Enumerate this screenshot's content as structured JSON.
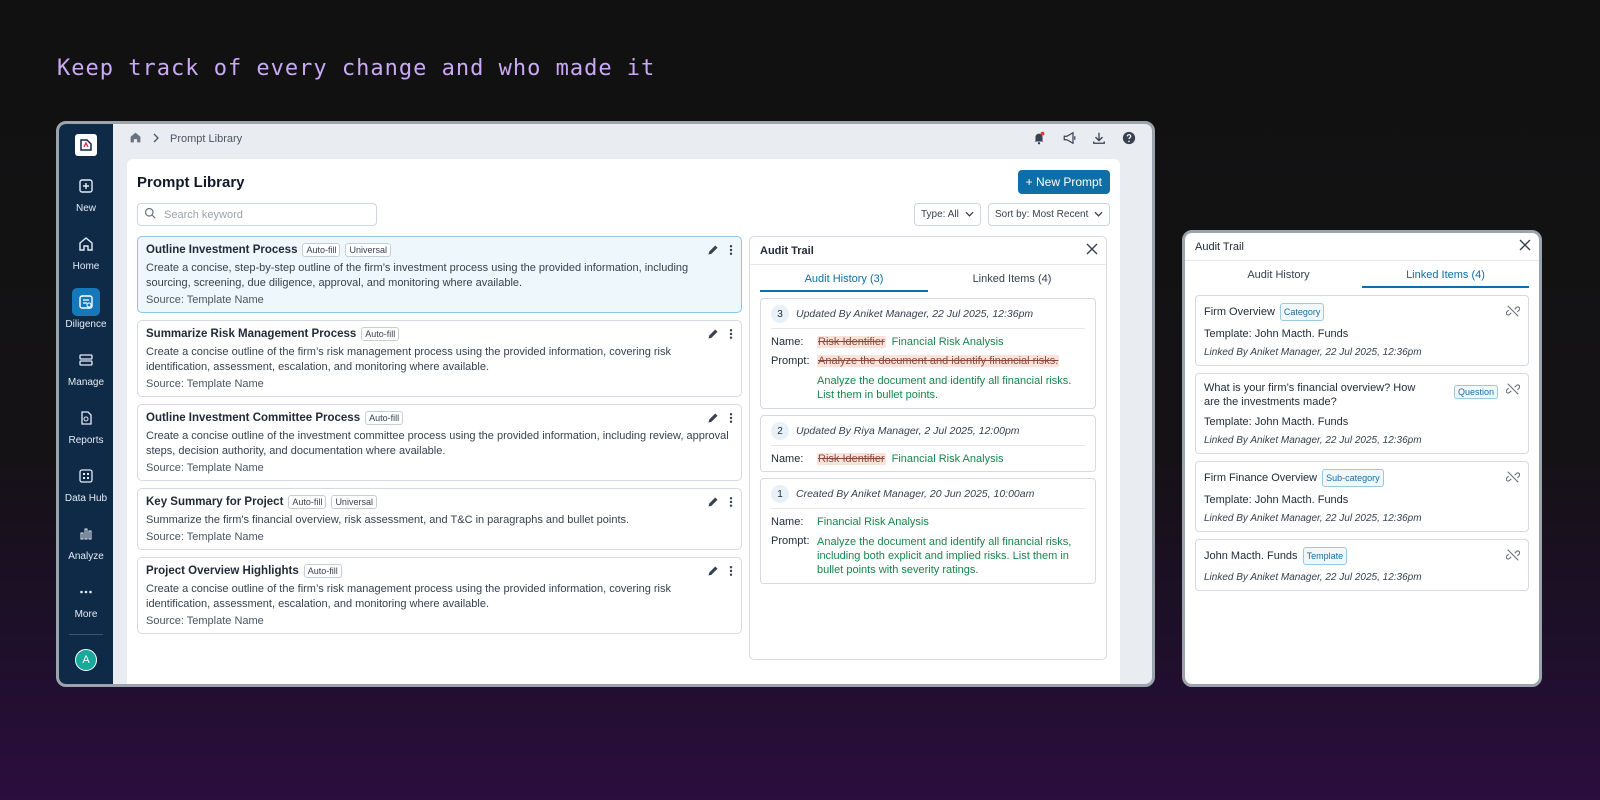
{
  "headline": "Keep track of every change and who made it",
  "rail": {
    "items": [
      {
        "label": "New",
        "icon": "plus-square-icon"
      },
      {
        "label": "Home",
        "icon": "home-icon"
      },
      {
        "label": "Diligence",
        "icon": "diligence-icon",
        "active": true
      },
      {
        "label": "Manage",
        "icon": "manage-icon"
      },
      {
        "label": "Reports",
        "icon": "reports-icon"
      },
      {
        "label": "Data Hub",
        "icon": "data-hub-icon"
      },
      {
        "label": "Analyze",
        "icon": "chart-icon"
      },
      {
        "label": "More",
        "icon": "more-icon"
      }
    ],
    "avatar": "A"
  },
  "breadcrumb": {
    "current": "Prompt Library"
  },
  "page": {
    "title": "Prompt Library",
    "new_button": "+ New Prompt",
    "search_placeholder": "Search keyword",
    "type_filter": "Type: All",
    "sort_filter": "Sort by: Most Recent"
  },
  "prompts": [
    {
      "title": "Outline Investment Process",
      "tags": [
        "Auto-fill",
        "Universal"
      ],
      "desc": "Create a concise, step-by-step outline of the firm’s investment process using the provided information, including sourcing, screening, due diligence, approval, and monitoring where available.",
      "source": "Source: Template Name"
    },
    {
      "title": "Summarize Risk Management Process",
      "tags": [
        "Auto-fill"
      ],
      "desc": "Create a concise outline of the firm’s risk management process using the provided information, covering risk identification, assessment, escalation, and monitoring where available.",
      "source": "Source: Template Name"
    },
    {
      "title": "Outline Investment Committee Process",
      "tags": [
        "Auto-fill"
      ],
      "desc": "Create a concise outline of the investment committee process using the provided information, including review, approval steps, decision authority, and documentation where available.",
      "source": "Source: Template Name"
    },
    {
      "title": "Key Summary for Project",
      "tags": [
        "Auto-fill",
        "Universal"
      ],
      "desc": "Summarize the firm's financial overview, risk assessment, and T&C in paragraphs and bullet points.",
      "source": "Source: Template Name"
    },
    {
      "title": "Project Overview Highlights",
      "tags": [
        "Auto-fill"
      ],
      "desc": "Create a concise outline of the firm’s risk management process using the provided information, covering risk identification, assessment, escalation, and monitoring where available.",
      "source": "Source: Template Name"
    }
  ],
  "audit": {
    "title": "Audit Trail",
    "tab_history": "Audit History (3)",
    "tab_linked": "Linked Items (4)",
    "name_label": "Name:",
    "prompt_label": "Prompt:",
    "entries": [
      {
        "num": "3",
        "header": "Updated By Aniket Manager, 22 Jul 2025, 12:36pm",
        "old_name": "Risk Identifier",
        "new_name": "Financial Risk Analysis",
        "old_prompt": "Analyze the document and identify financial risks.",
        "new_prompt": "Analyze the document and identify all financial risks. List them in bullet points."
      },
      {
        "num": "2",
        "header": "Updated By Riya Manager, 2 Jul 2025, 12:00pm",
        "old_name": "Risk Identifier",
        "new_name": "Financial Risk Analysis"
      },
      {
        "num": "1",
        "header": "Created By Aniket Manager, 20 Jun 2025, 10:00am",
        "new_name": "Financial Risk Analysis",
        "new_prompt": "Analyze the document and identify all financial risks, including both explicit and implied risks. List them in bullet points with severity ratings."
      }
    ]
  },
  "side": {
    "title": "Audit Trail",
    "tab_history": "Audit History",
    "tab_linked": "Linked Items (4)",
    "items": [
      {
        "title": "Firm Overview",
        "tag": "Category",
        "template": "Template: John Macth. Funds",
        "by": "Linked By Aniket Manager, 22 Jul 2025, 12:36pm"
      },
      {
        "title": "What is your firm’s financial overview? How are the investments made?",
        "tag": "Question",
        "template": "Template: John Macth. Funds",
        "by": "Linked By Aniket Manager, 22 Jul 2025, 12:36pm"
      },
      {
        "title": "Firm Finance Overview",
        "tag": "Sub-category",
        "template": "Template: John Macth. Funds",
        "by": "Linked By Aniket Manager, 22 Jul 2025, 12:36pm"
      },
      {
        "title": "John Macth. Funds",
        "tag": "Template",
        "by": "Linked By Aniket Manager, 22 Jul 2025, 12:36pm"
      }
    ]
  },
  "colors": {
    "accent": "#0d6ea8",
    "rail": "#0f2a47",
    "added": "#17864b",
    "removed_bg": "#fbe3dc"
  }
}
